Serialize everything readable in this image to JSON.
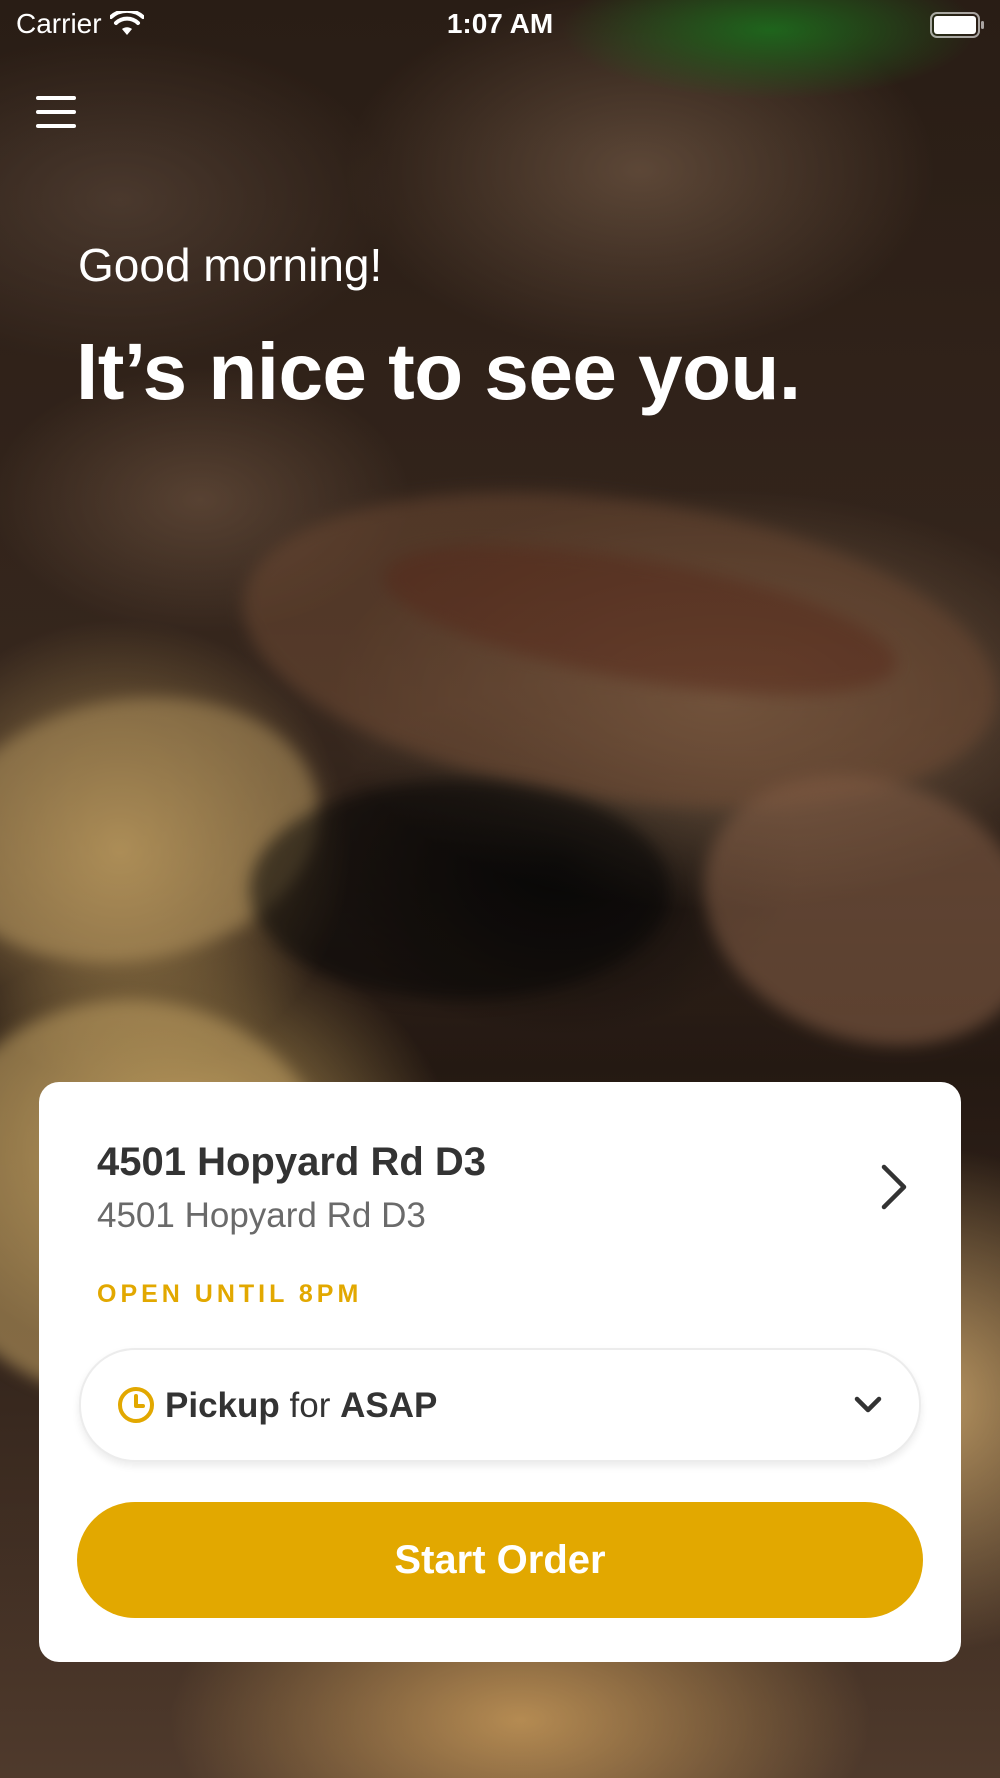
{
  "status_bar": {
    "carrier": "Carrier",
    "time": "1:07 AM"
  },
  "hero": {
    "greeting": "Good morning!",
    "headline": "It’s nice to see you."
  },
  "store": {
    "name": "4501 Hopyard Rd D3",
    "address": "4501 Hopyard Rd D3",
    "hours": "OPEN UNTIL 8PM"
  },
  "order_time": {
    "mode": "Pickup",
    "connector": "for",
    "time": "ASAP"
  },
  "actions": {
    "start_order": "Start Order"
  },
  "colors": {
    "accent": "#E2A800",
    "text_dark": "#333333",
    "text_muted": "#6A6A6A",
    "card_bg": "#FFFFFF"
  },
  "icons": {
    "menu": "hamburger-menu-icon",
    "wifi": "wifi-icon",
    "battery": "battery-icon",
    "store_chevron": "chevron-right-icon",
    "clock": "clock-icon",
    "dropdown": "chevron-down-icon"
  }
}
